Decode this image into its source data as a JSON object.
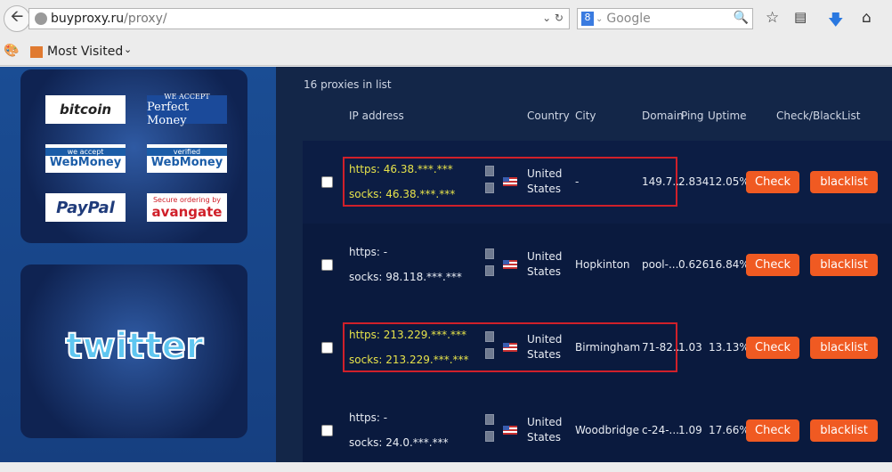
{
  "browser": {
    "url_host": "buyproxy.ru",
    "url_path": "/proxy/",
    "search_placeholder": "Google",
    "search_engine_letter": "8",
    "bookmark_folder": "Most Visited"
  },
  "sidebar": {
    "payment_logos": [
      {
        "text": "bitcoin",
        "sub": ""
      },
      {
        "text": "Perfect Money",
        "sub": "WE ACCEPT"
      },
      {
        "text": "WebMoney",
        "sub": "we accept"
      },
      {
        "text": "WebMoney",
        "sub": "verified"
      },
      {
        "text": "PayPal",
        "sub": ""
      },
      {
        "text": "avangate",
        "sub": "Secure ordering by"
      }
    ],
    "twitter_logo": "twitter"
  },
  "main": {
    "count_text": "16 proxies in list",
    "headers": {
      "ip": "IP address",
      "country": "Country",
      "city": "City",
      "domain": "Domain",
      "ping": "Ping",
      "uptime": "Uptime",
      "actions": "Check/BlackList"
    },
    "rows": [
      {
        "https": "https: 46.38.***.***",
        "socks": "socks: 46.38.***.***",
        "country": "United States",
        "city": "-",
        "domain": "149.7...",
        "ping": "2.834",
        "uptime": "12.05%",
        "highlighted": true,
        "check": "Check",
        "blacklist": "blacklist"
      },
      {
        "https": "https: -",
        "socks": "socks: 98.118.***.***",
        "country": "United States",
        "city": "Hopkinton",
        "domain": "pool-...",
        "ping": "0.626",
        "uptime": "16.84%",
        "highlighted": false,
        "check": "Check",
        "blacklist": "blacklist"
      },
      {
        "https": "https: 213.229.***.***",
        "socks": "socks: 213.229.***.***",
        "country": "United States",
        "city": "Birmingham",
        "domain": "71-82...",
        "ping": "1.03",
        "uptime": "13.13%",
        "highlighted": true,
        "check": "Check",
        "blacklist": "blacklist"
      },
      {
        "https": "https: -",
        "socks": "socks: 24.0.***.***",
        "country": "United States",
        "city": "Woodbridge",
        "domain": "c-24-...",
        "ping": "1.09",
        "uptime": "17.66%",
        "highlighted": false,
        "check": "Check",
        "blacklist": "blacklist"
      }
    ]
  },
  "colors": {
    "button": "#f05a22",
    "highlight_box": "#d0202a",
    "highlight_text": "#e6e24a"
  }
}
